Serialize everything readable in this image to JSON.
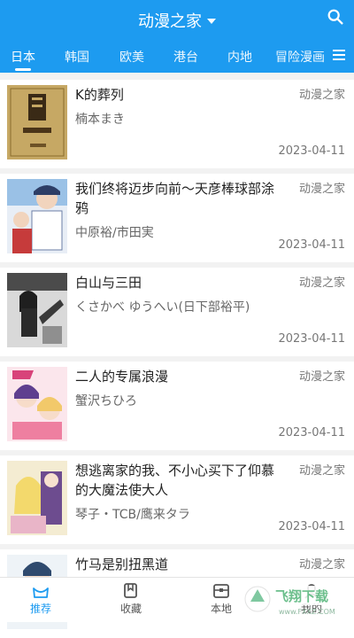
{
  "header": {
    "title": "动漫之家",
    "search_icon": "search-icon",
    "menu_icon": "menu-icon"
  },
  "tabs": [
    {
      "label": "日本",
      "active": true
    },
    {
      "label": "韩国"
    },
    {
      "label": "欧美"
    },
    {
      "label": "港台"
    },
    {
      "label": "内地"
    },
    {
      "label": "冒险漫画"
    }
  ],
  "list": [
    {
      "title": "K的葬列",
      "author": "楠本まき",
      "source": "动漫之家",
      "date": "2023-04-11"
    },
    {
      "title": "我们终将迈步向前～天彦棒球部涂鸦",
      "author": "中原裕/市田実",
      "source": "动漫之家",
      "date": "2023-04-11"
    },
    {
      "title": "白山与三田",
      "author": "くさかべ ゆうへい(日下部裕平)",
      "source": "动漫之家",
      "date": "2023-04-11"
    },
    {
      "title": "二人的专属浪漫",
      "author": "蟹沢ちひろ",
      "source": "动漫之家",
      "date": "2023-04-11"
    },
    {
      "title": "想逃离家的我、不小心买下了仰慕的大魔法使大人",
      "author": "琴子・TCB/鹰来タラ",
      "source": "动漫之家",
      "date": "2023-04-11"
    },
    {
      "title": "竹马是别扭黑道",
      "author": "",
      "source": "动漫之家",
      "date": ""
    }
  ],
  "bottom_nav": [
    {
      "label": "推荐",
      "icon": "recommend-icon",
      "active": true
    },
    {
      "label": "收藏",
      "icon": "bookmark-icon"
    },
    {
      "label": "本地",
      "icon": "local-box-icon"
    },
    {
      "label": "我的",
      "icon": "profile-icon"
    }
  ],
  "watermark": {
    "text": "飞翔下载",
    "sub": "www.FXXZ.COM"
  },
  "colors": {
    "brand": "#1d9bf0",
    "background": "#f2f2f2"
  }
}
